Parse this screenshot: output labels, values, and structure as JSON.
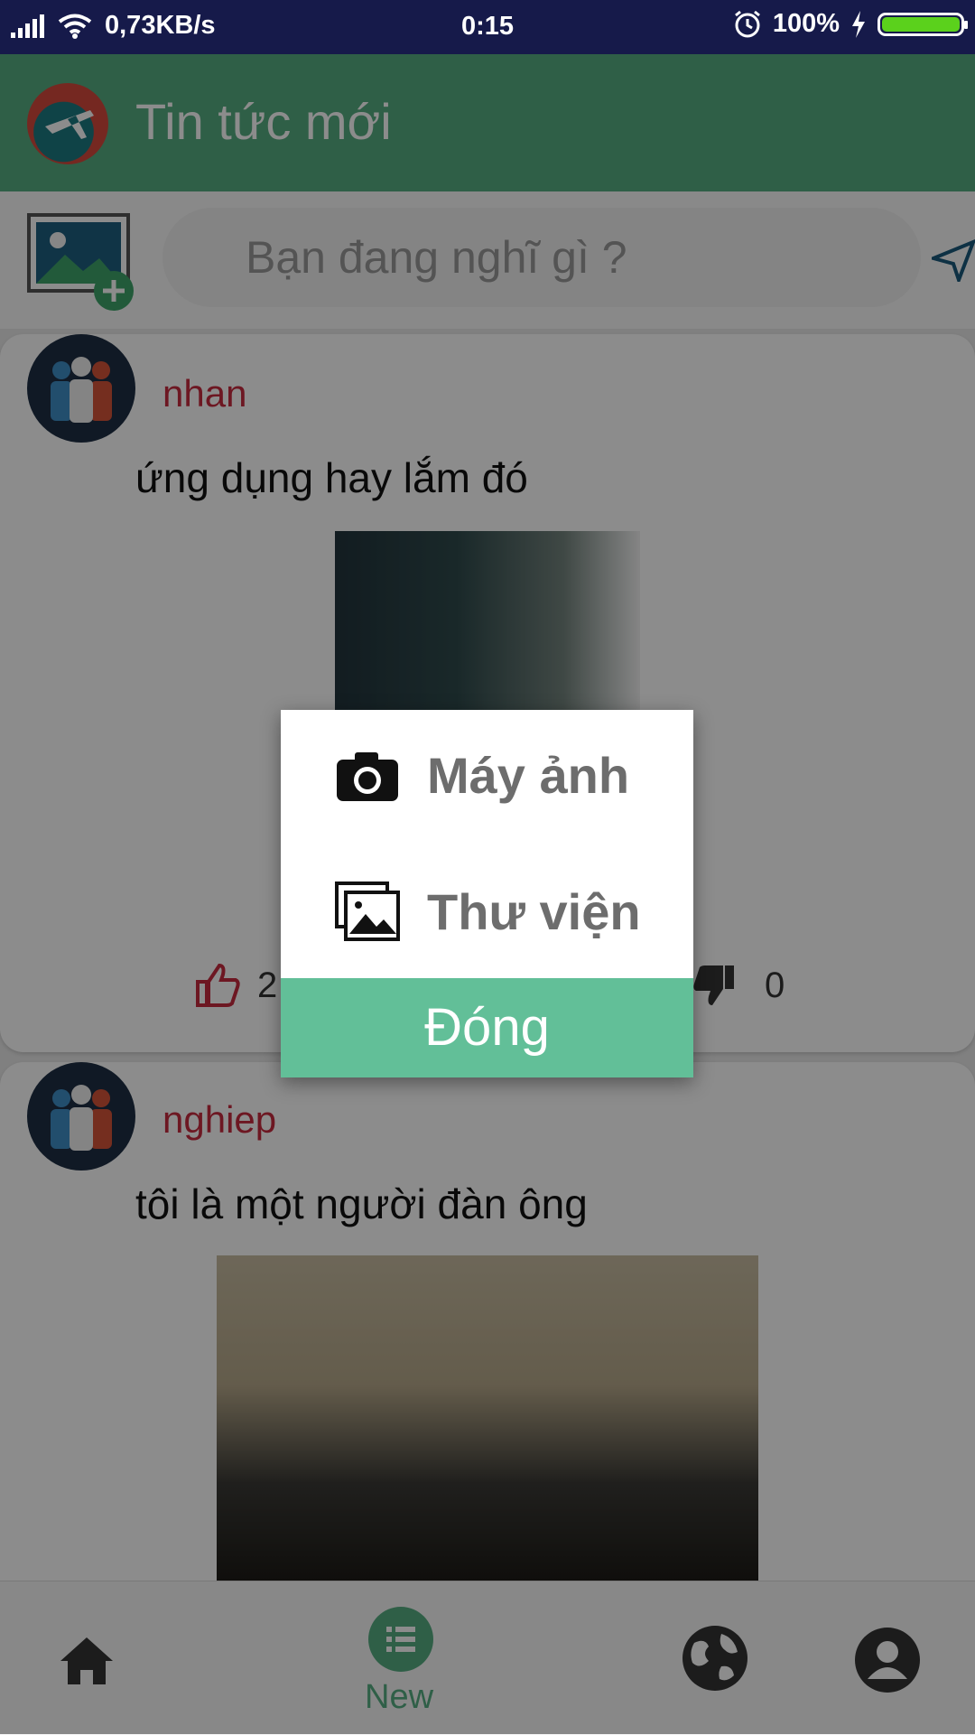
{
  "status_bar": {
    "network_speed": "0,73KB/s",
    "time": "0:15",
    "battery": "100%",
    "icons": [
      "signal-icon",
      "wifi-icon",
      "alarm-icon",
      "charging-icon",
      "battery-icon"
    ]
  },
  "app_bar": {
    "title": "Tin tức mới",
    "logo": "app-logo-globe-plane"
  },
  "composer": {
    "placeholder": "Bạn đang nghĩ gì ?",
    "add_image_icon": "add-image-icon",
    "send_icon": "send-icon"
  },
  "posts": [
    {
      "author": "nhan",
      "text": "ứng dụng hay lắm đó",
      "likes": "2",
      "dislikes": "0"
    },
    {
      "author": "nghiep",
      "text": "tôi là một người đàn ông"
    }
  ],
  "bottom_nav": {
    "items": [
      {
        "icon": "home-icon"
      },
      {
        "icon": "list-icon",
        "label": "New"
      },
      {
        "icon": "globe-icon"
      },
      {
        "icon": "profile-icon"
      }
    ]
  },
  "dialog": {
    "options": [
      {
        "label": "Máy ảnh",
        "icon": "camera-icon"
      },
      {
        "label": "Thư viện",
        "icon": "gallery-icon"
      }
    ],
    "close_label": "Đóng"
  },
  "colors": {
    "primary": "#56ad82",
    "accent_button": "#62bf98",
    "author": "#c62b3f",
    "status_bar": "#161a4a"
  }
}
